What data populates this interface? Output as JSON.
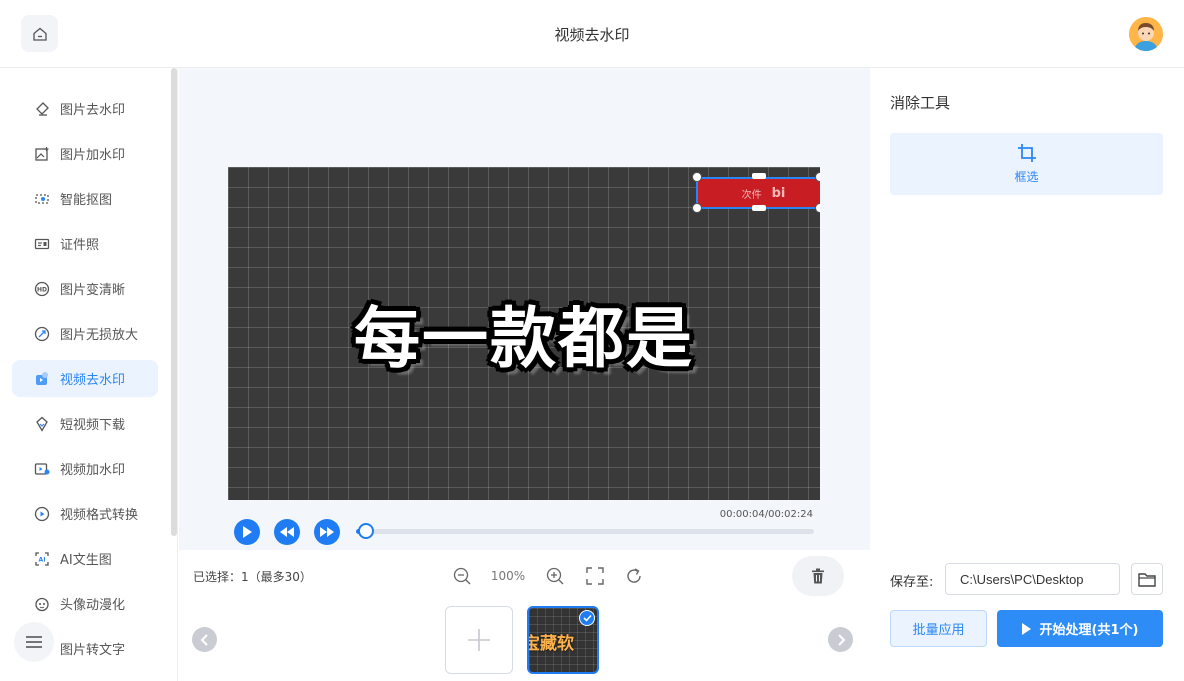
{
  "header": {
    "title": "视频去水印",
    "home_icon": "home-icon",
    "avatar": "user-avatar"
  },
  "sidebar": {
    "items": [
      {
        "label": "图片去水印",
        "icon": "eraser-icon"
      },
      {
        "label": "图片加水印",
        "icon": "image-add-icon"
      },
      {
        "label": "智能抠图",
        "icon": "cutout-icon"
      },
      {
        "label": "证件照",
        "icon": "id-card-icon"
      },
      {
        "label": "图片变清晰",
        "icon": "hd-icon"
      },
      {
        "label": "图片无损放大",
        "icon": "enlarge-icon"
      },
      {
        "label": "视频去水印",
        "icon": "video-eraser-icon",
        "active": true
      },
      {
        "label": "短视频下载",
        "icon": "download-icon"
      },
      {
        "label": "视频加水印",
        "icon": "video-add-icon"
      },
      {
        "label": "视频格式转换",
        "icon": "convert-icon"
      },
      {
        "label": "AI文生图",
        "icon": "ai-image-icon"
      },
      {
        "label": "头像动漫化",
        "icon": "anime-icon"
      },
      {
        "label": "图片转文字",
        "icon": "ocr-icon"
      }
    ],
    "menu_icon": "menu-icon"
  },
  "video": {
    "caption": "每一款都是",
    "watermark_text": "次件",
    "watermark_mark": "bi",
    "time": "00:00:04/00:02:24",
    "progress": 0.03
  },
  "toolbar": {
    "selected": "已选择：1（最多30）",
    "zoom": "100%"
  },
  "thumbnails": {
    "thumb_text": "宝藏软"
  },
  "right": {
    "title": "消除工具",
    "tool_label": "框选",
    "save_label": "保存至:",
    "save_path": "C:\\Users\\PC\\Desktop",
    "batch_label": "批量应用",
    "start_label": "开始处理(共1个)"
  },
  "colors": {
    "accent": "#2b86f5",
    "play": "#1f7cf2",
    "watermark": "#c81e23"
  }
}
